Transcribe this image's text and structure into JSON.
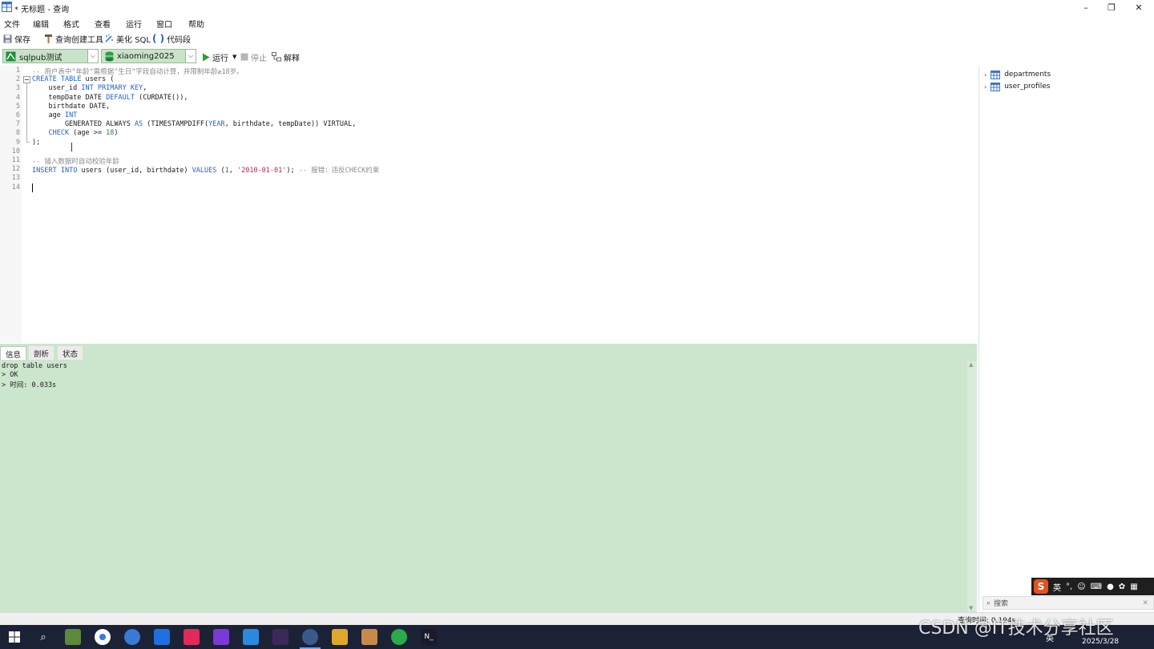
{
  "window": {
    "title": "* 无标题 - 查询",
    "minimize": "–",
    "restore": "❐",
    "close": "✕"
  },
  "menu": [
    "文件",
    "编辑",
    "格式",
    "查看",
    "运行",
    "窗口",
    "帮助"
  ],
  "toolbar": {
    "save": "保存",
    "query_builder": "查询创建工具",
    "beautify": "美化 SQL",
    "snippet": "代码段"
  },
  "connection": {
    "server": "sqlpub测试",
    "database": "xiaoming2025",
    "run": "运行",
    "stop": "停止",
    "explain": "解释"
  },
  "editor": {
    "line_numbers": [
      "1",
      "2",
      "3",
      "4",
      "5",
      "6",
      "7",
      "8",
      "9",
      "10",
      "11",
      "12",
      "13",
      "14"
    ],
    "lines": [
      "-- 用户表中\"年龄\"需根据\"生日\"字段自动计算，并限制年龄≥18岁。",
      "CREATE TABLE users (",
      "    user_id INT PRIMARY KEY,",
      "    tempDate DATE DEFAULT (CURDATE()),",
      "    birthdate DATE,",
      "    age INT",
      "        GENERATED ALWAYS AS (TIMESTAMPDIFF(YEAR, birthdate, tempDate)) VIRTUAL,",
      "    CHECK (age >= 18)",
      ");",
      "",
      "-- 插入数据时自动校验年龄",
      "INSERT INTO users (user_id, birthdate) VALUES (1, '2010-01-01'); -- 报错：违反CHECK约束",
      "",
      ""
    ]
  },
  "objects": {
    "tables": [
      "departments",
      "user_profiles"
    ]
  },
  "results": {
    "tabs": [
      "信息",
      "剖析",
      "状态"
    ],
    "lines": [
      "drop table users",
      "> OK",
      "> 时间: 0.033s"
    ]
  },
  "status": {
    "query_time": "查询时间: 0.194s"
  },
  "ime": {
    "mode": "英",
    "punct": "°,"
  },
  "search": {
    "placeholder": "搜索"
  },
  "tray": {
    "lang": "英",
    "date": "2025/3/28"
  },
  "watermark": "CSDN @IT技术分享社区",
  "colors": {
    "results_bg": "#cce5cd",
    "keyword": "#1f5fd6",
    "comment": "#8a8a8a",
    "string": "#c21f4a",
    "number": "#1a8a3a",
    "taskbar": "#1c2236"
  }
}
